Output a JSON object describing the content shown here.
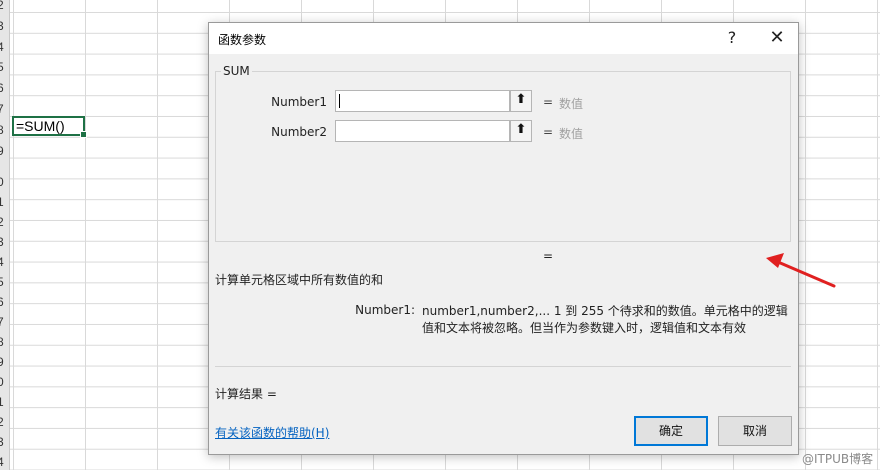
{
  "sheet": {
    "row_numbers": [
      "2",
      "3",
      "4",
      "5",
      "6",
      "7",
      "8",
      "9",
      "0",
      "1",
      "2",
      "3",
      "4",
      "5",
      "6",
      "7",
      "8",
      "9",
      "0",
      "1",
      "2",
      "3",
      "4"
    ],
    "active_cell_formula": "=SUM()"
  },
  "dialog": {
    "title": "函数参数",
    "help_glyph": "?",
    "close_glyph": "✕",
    "function_name": "SUM",
    "args": [
      {
        "label": "Number1",
        "value": "",
        "equals": "=",
        "hint": "数值"
      },
      {
        "label": "Number2",
        "value": "",
        "equals": "=",
        "hint": "数值"
      }
    ],
    "ref_button_glyph": "⬆",
    "result_equals": "=",
    "description": "计算单元格区域中所有数值的和",
    "arg_detail_name": "Number1:",
    "arg_detail_text": "number1,number2,...  1 到 255 个待求和的数值。单元格中的逻辑值和文本将被忽略。但当作为参数键入时，逻辑值和文本有效",
    "calc_result": "计算结果 =",
    "help_link": "有关该函数的帮助(H)",
    "ok_label": "确定",
    "cancel_label": "取消"
  },
  "annotation": {
    "color": "#e02020"
  },
  "watermark": "@ITPUB博客"
}
